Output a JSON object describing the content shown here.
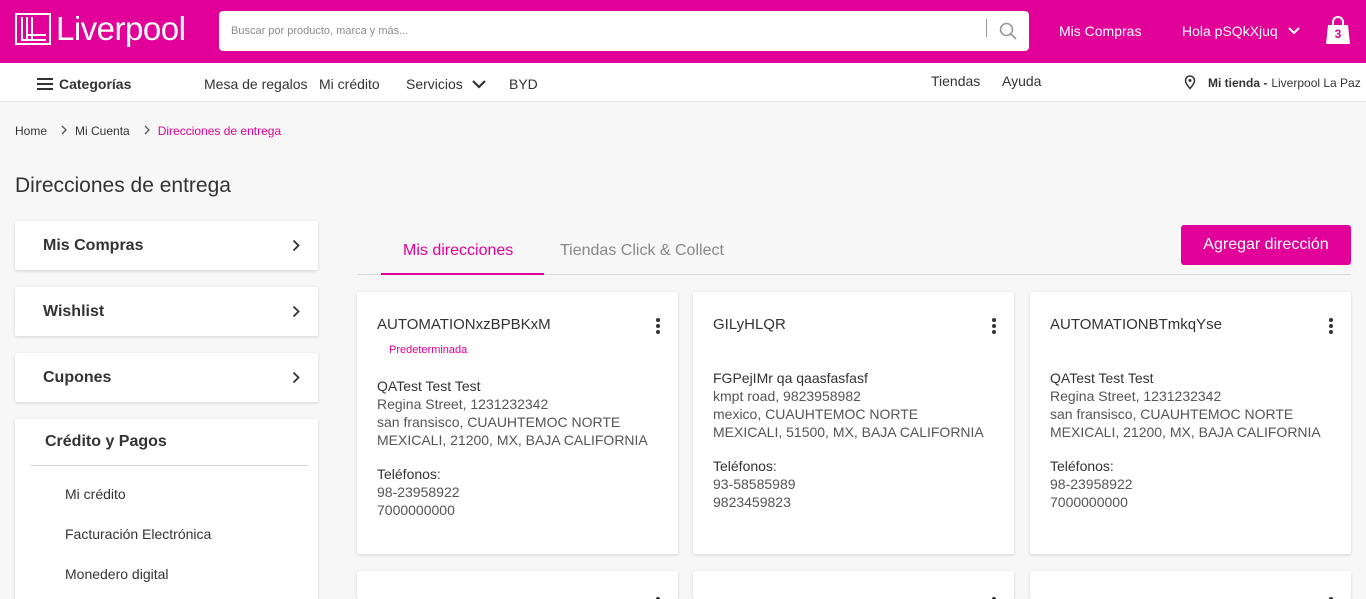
{
  "header": {
    "brand": "Liverpool",
    "search_placeholder": "Buscar por producto, marca y más...",
    "mis_compras": "Mis Compras",
    "greeting": "Hola pSQkXjuq",
    "cart_count": "3",
    "brand_color": "#e10098"
  },
  "subnav": {
    "categorias": "Categorías",
    "mesa": "Mesa de regalos",
    "credito": "Mi crédito",
    "servicios": "Servicios",
    "byd": "BYD",
    "tiendas": "Tiendas",
    "ayuda": "Ayuda",
    "store_label": "Mi tienda -",
    "store_name": "Liverpool La Paz"
  },
  "breadcrumb": {
    "home": "Home",
    "account": "Mi Cuenta",
    "current": "Direcciones de entrega"
  },
  "page_title": "Direcciones de entrega",
  "sidebar": {
    "items": [
      {
        "label": "Mis Compras"
      },
      {
        "label": "Wishlist"
      },
      {
        "label": "Cupones"
      }
    ],
    "credit": {
      "title": "Crédito y Pagos",
      "items": [
        "Mi crédito",
        "Facturación Electrónica",
        "Monedero digital"
      ]
    }
  },
  "tabs": {
    "active": "Mis direcciones",
    "other": "Tiendas Click & Collect"
  },
  "add_button": "Agregar dirección",
  "addresses": [
    {
      "name": "AUTOMATIONxzBPBKxM",
      "badge": "Predeterminada",
      "person": "QATest Test Test",
      "line1": "Regina Street, 1231232342",
      "line2": "san fransisco, CUAUHTEMOC NORTE",
      "line3": "MEXICALI, 21200, MX, BAJA CALIFORNIA",
      "tel_label": "Teléfonos:",
      "tel1": "98-23958922",
      "tel2": "7000000000"
    },
    {
      "name": "GILyHLQR",
      "person": "FGPejIMr qa qaasfasfasf",
      "line1": "kmpt road, 9823958982",
      "line2": "mexico, CUAUHTEMOC NORTE",
      "line3": "MEXICALI, 51500, MX, BAJA CALIFORNIA",
      "tel_label": "Teléfonos:",
      "tel1": "93-58585989",
      "tel2": "9823459823"
    },
    {
      "name": "AUTOMATIONBTmkqYse",
      "person": "QATest Test Test",
      "line1": "Regina Street, 1231232342",
      "line2": "san fransisco, CUAUHTEMOC NORTE",
      "line3": "MEXICALI, 21200, MX, BAJA CALIFORNIA",
      "tel_label": "Teléfonos:",
      "tel1": "98-23958922",
      "tel2": "7000000000"
    }
  ]
}
